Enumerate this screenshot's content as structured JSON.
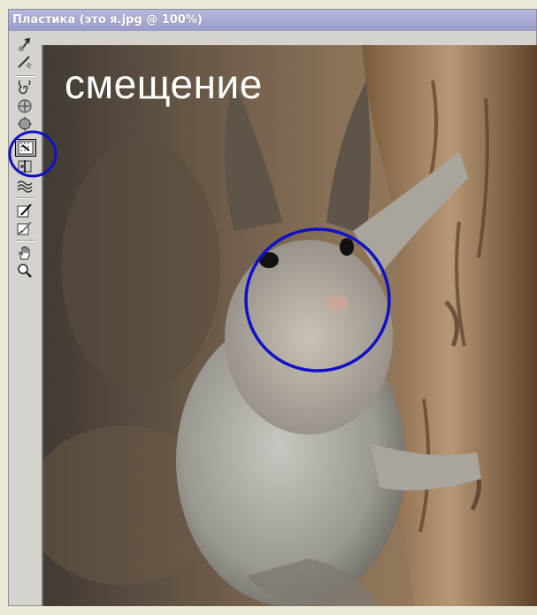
{
  "window": {
    "title": "Пластика (это я.jpg @  100%)"
  },
  "canvas": {
    "caption": "смещение"
  },
  "toolbar": {
    "tools": [
      {
        "icon": "forward-warp-icon"
      },
      {
        "icon": "reconstruct-icon"
      },
      {
        "icon": "twirl-clockwise-icon"
      },
      {
        "icon": "pucker-icon"
      },
      {
        "icon": "bloat-icon"
      },
      {
        "icon": "push-left-icon",
        "selected": true
      },
      {
        "icon": "mirror-icon"
      },
      {
        "icon": "turbulence-icon"
      },
      {
        "icon": "freeze-mask-icon"
      },
      {
        "icon": "thaw-mask-icon"
      },
      {
        "icon": "hand-icon"
      },
      {
        "icon": "zoom-icon"
      }
    ]
  },
  "colors": {
    "annotation": "#1010c8",
    "titlebar": "#9a9cc9",
    "panel": "#d6d3ce"
  }
}
